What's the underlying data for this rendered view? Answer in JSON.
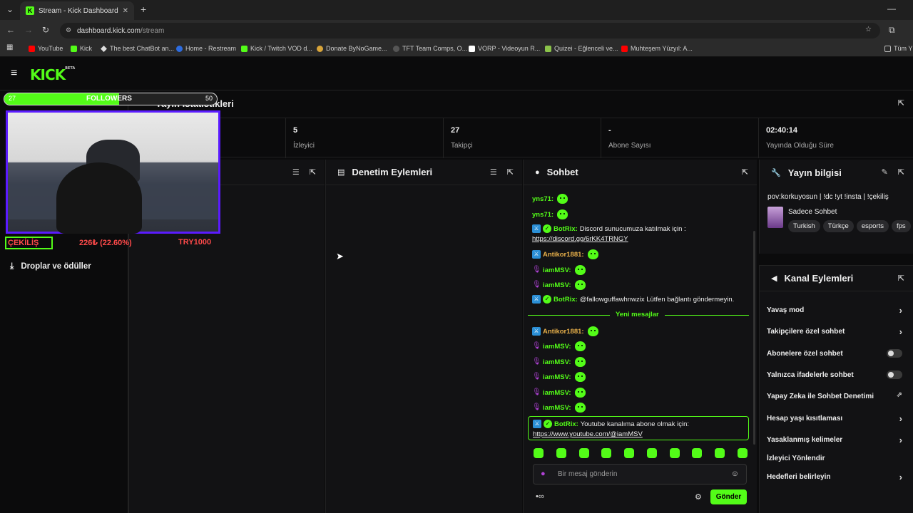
{
  "browser": {
    "tab_title": "Stream - Kick Dashboard",
    "url_host": "dashboard.kick.com",
    "url_path": "/stream",
    "bookmarks": [
      "YouTube",
      "Kick",
      "The best ChatBot an...",
      "Home - Restream",
      "Kick / Twitch VOD d...",
      "Donate ByNoGame...",
      "TFT Team Comps, O...",
      "VORP - Videoyun R...",
      "Quizei - Eğlenceli ve...",
      "Muhteşem Yüzyıl: A...",
      "Tüm Y"
    ]
  },
  "kick": {
    "logo": "KICK",
    "logo_sup": "BETA"
  },
  "overlay": {
    "followers_current": "27",
    "followers_label": "FOLLOWERS",
    "followers_goal": "50",
    "followers_progress": 0.54,
    "cekilis_label": "ÇEKİLİŞ",
    "cekilis_amount": "226₺ (22.60%)",
    "cekilis_goal": "TRY1000"
  },
  "sidebar": {
    "drops": "Droplar ve ödüller"
  },
  "stats": {
    "title": "Yayın İstatistikleri",
    "items": [
      {
        "value": "5",
        "label": "İzleyici"
      },
      {
        "value": "27",
        "label": "Takipçi"
      },
      {
        "value": "-",
        "label": "Abone Sayısı"
      },
      {
        "value": "02:40:14",
        "label": "Yayında Olduğu Süre"
      }
    ]
  },
  "panels": {
    "moderation": "Denetim Eylemleri",
    "chat": "Sohbet",
    "stream_info": "Yayın bilgisi",
    "channel_actions": "Kanal Eylemleri"
  },
  "chat": {
    "messages": [
      {
        "user": "yns71:",
        "color": "#53fc18",
        "badge": "none",
        "text": "",
        "emote": true
      },
      {
        "user": "yns71:",
        "color": "#53fc18",
        "badge": "none",
        "text": "",
        "emote": true
      },
      {
        "user": "BotRix:",
        "color": "#53fc18",
        "badge": "modver",
        "text": "Discord sunucumuza katılmak için :",
        "emote": false
      },
      {
        "user": "",
        "color": "",
        "badge": "none",
        "text": "https://discord.gg/6rKK4TRNGY",
        "emote": false
      },
      {
        "user": "Antikor1881:",
        "color": "#e8b04a",
        "badge": "mod",
        "text": "",
        "emote": true
      },
      {
        "user": "iamMSV:",
        "color": "#53fc18",
        "badge": "mic",
        "text": "",
        "emote": true
      },
      {
        "user": "iamMSV:",
        "color": "#53fc18",
        "badge": "mic",
        "text": "",
        "emote": true
      },
      {
        "user": "BotRix:",
        "color": "#53fc18",
        "badge": "modver",
        "text": "@fallowguffawhnwzix Lütfen bağlantı göndermeyin.",
        "emote": false
      },
      {
        "user": "Antikor1881:",
        "color": "#e8b04a",
        "badge": "mod",
        "text": "",
        "emote": true
      },
      {
        "user": "iamMSV:",
        "color": "#53fc18",
        "badge": "mic",
        "text": "",
        "emote": true
      },
      {
        "user": "iamMSV:",
        "color": "#53fc18",
        "badge": "mic",
        "text": "",
        "emote": true
      },
      {
        "user": "iamMSV:",
        "color": "#53fc18",
        "badge": "mic",
        "text": "",
        "emote": true
      },
      {
        "user": "iamMSV:",
        "color": "#53fc18",
        "badge": "mic",
        "text": "",
        "emote": true
      },
      {
        "user": "iamMSV:",
        "color": "#53fc18",
        "badge": "mic",
        "text": "",
        "emote": true
      }
    ],
    "new_messages": "Yeni mesajlar",
    "pinned_user": "BotRix:",
    "pinned_text": "Youtube kanalıma abone olmak için:",
    "pinned_link": "https://www.youtube.com/@iamMSV",
    "input_placeholder": "Bir mesaj gönderin",
    "send": "Gönder"
  },
  "stream_info": {
    "title": "pov:korkuyosun | !dc !yt !insta | !çekiliş",
    "category": "Sadece Sohbet",
    "tags": [
      "Turkish",
      "Türkçe",
      "esports",
      "fps"
    ]
  },
  "channel_actions": [
    {
      "label": "Yavaş mod",
      "control": "chevron"
    },
    {
      "label": "Takipçilere özel sohbet",
      "control": "chevron"
    },
    {
      "label": "Abonelere özel sohbet",
      "control": "toggle"
    },
    {
      "label": "Yalnızca ifadelerle sohbet",
      "control": "toggle"
    },
    {
      "label": "Yapay Zeka ile Sohbet Denetimi",
      "control": "external"
    },
    {
      "label": "Hesap yaşı kısıtlaması",
      "control": "chevron"
    },
    {
      "label": "Yasaklanmış kelimeler",
      "control": "chevron"
    },
    {
      "label": "İzleyici Yönlendir",
      "control": "none"
    },
    {
      "label": "Hedefleri belirleyin",
      "control": "chevron"
    }
  ],
  "colors": {
    "brand": "#53fc18",
    "overlay_border": "#5b1bff",
    "mod_badge": "#2b8fd6",
    "cekilis_red": "#ff4a4a"
  }
}
